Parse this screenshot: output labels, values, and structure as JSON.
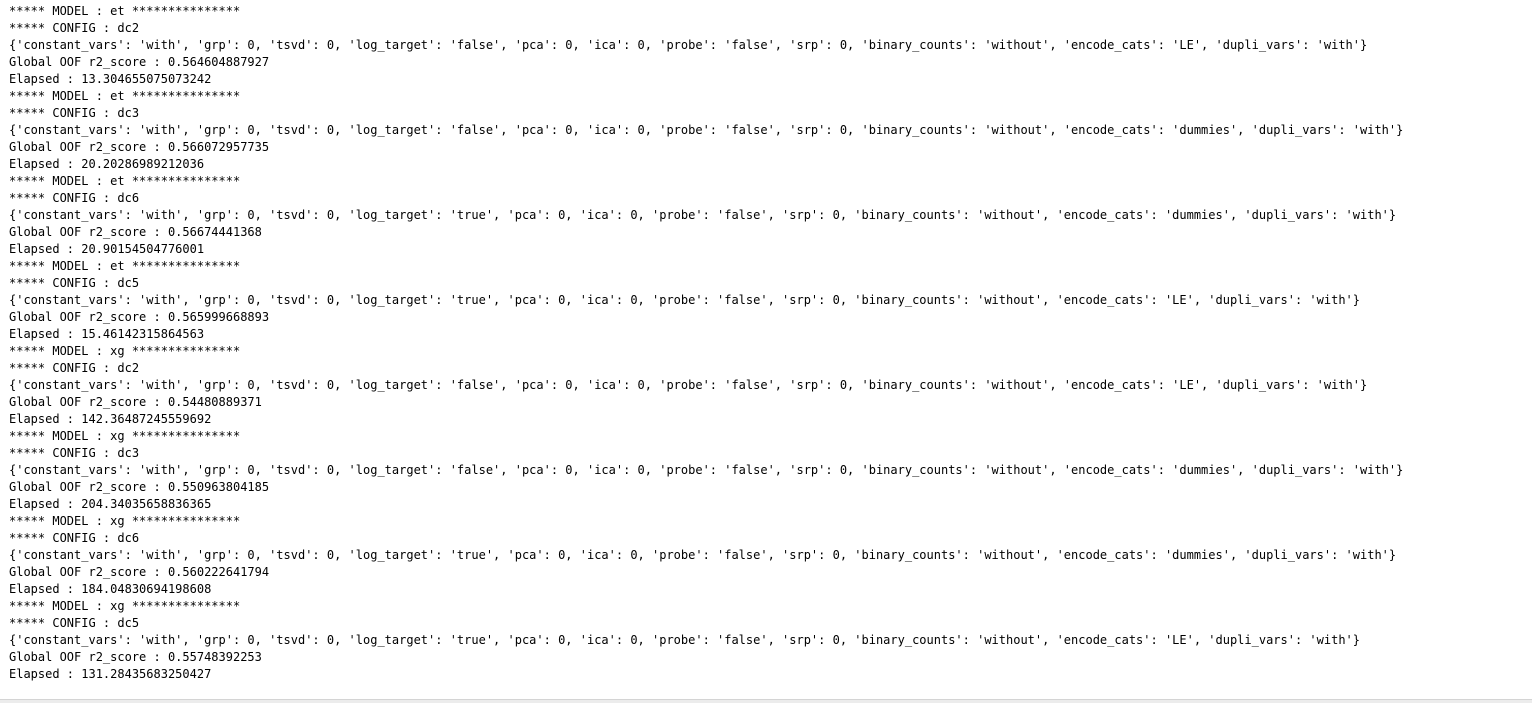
{
  "output": {
    "lines": [
      "***** MODEL : et ***************",
      "***** CONFIG : dc2",
      "{'constant_vars': 'with', 'grp': 0, 'tsvd': 0, 'log_target': 'false', 'pca': 0, 'ica': 0, 'probe': 'false', 'srp': 0, 'binary_counts': 'without', 'encode_cats': 'LE', 'dupli_vars': 'with'}",
      "Global OOF r2_score : 0.564604887927",
      "Elapsed : 13.304655075073242",
      "***** MODEL : et ***************",
      "***** CONFIG : dc3",
      "{'constant_vars': 'with', 'grp': 0, 'tsvd': 0, 'log_target': 'false', 'pca': 0, 'ica': 0, 'probe': 'false', 'srp': 0, 'binary_counts': 'without', 'encode_cats': 'dummies', 'dupli_vars': 'with'}",
      "Global OOF r2_score : 0.566072957735",
      "Elapsed : 20.20286989212036",
      "***** MODEL : et ***************",
      "***** CONFIG : dc6",
      "{'constant_vars': 'with', 'grp': 0, 'tsvd': 0, 'log_target': 'true', 'pca': 0, 'ica': 0, 'probe': 'false', 'srp': 0, 'binary_counts': 'without', 'encode_cats': 'dummies', 'dupli_vars': 'with'}",
      "Global OOF r2_score : 0.56674441368",
      "Elapsed : 20.90154504776001",
      "***** MODEL : et ***************",
      "***** CONFIG : dc5",
      "{'constant_vars': 'with', 'grp': 0, 'tsvd': 0, 'log_target': 'true', 'pca': 0, 'ica': 0, 'probe': 'false', 'srp': 0, 'binary_counts': 'without', 'encode_cats': 'LE', 'dupli_vars': 'with'}",
      "Global OOF r2_score : 0.565999668893",
      "Elapsed : 15.46142315864563",
      "***** MODEL : xg ***************",
      "***** CONFIG : dc2",
      "{'constant_vars': 'with', 'grp': 0, 'tsvd': 0, 'log_target': 'false', 'pca': 0, 'ica': 0, 'probe': 'false', 'srp': 0, 'binary_counts': 'without', 'encode_cats': 'LE', 'dupli_vars': 'with'}",
      "Global OOF r2_score : 0.54480889371",
      "Elapsed : 142.36487245559692",
      "***** MODEL : xg ***************",
      "***** CONFIG : dc3",
      "{'constant_vars': 'with', 'grp': 0, 'tsvd': 0, 'log_target': 'false', 'pca': 0, 'ica': 0, 'probe': 'false', 'srp': 0, 'binary_counts': 'without', 'encode_cats': 'dummies', 'dupli_vars': 'with'}",
      "Global OOF r2_score : 0.550963804185",
      "Elapsed : 204.34035658836365",
      "***** MODEL : xg ***************",
      "***** CONFIG : dc6",
      "{'constant_vars': 'with', 'grp': 0, 'tsvd': 0, 'log_target': 'true', 'pca': 0, 'ica': 0, 'probe': 'false', 'srp': 0, 'binary_counts': 'without', 'encode_cats': 'dummies', 'dupli_vars': 'with'}",
      "Global OOF r2_score : 0.560222641794",
      "Elapsed : 184.04830694198608",
      "***** MODEL : xg ***************",
      "***** CONFIG : dc5",
      "{'constant_vars': 'with', 'grp': 0, 'tsvd': 0, 'log_target': 'true', 'pca': 0, 'ica': 0, 'probe': 'false', 'srp': 0, 'binary_counts': 'without', 'encode_cats': 'LE', 'dupli_vars': 'with'}",
      "Global OOF r2_score : 0.55748392253",
      "Elapsed : 131.28435683250427"
    ]
  }
}
